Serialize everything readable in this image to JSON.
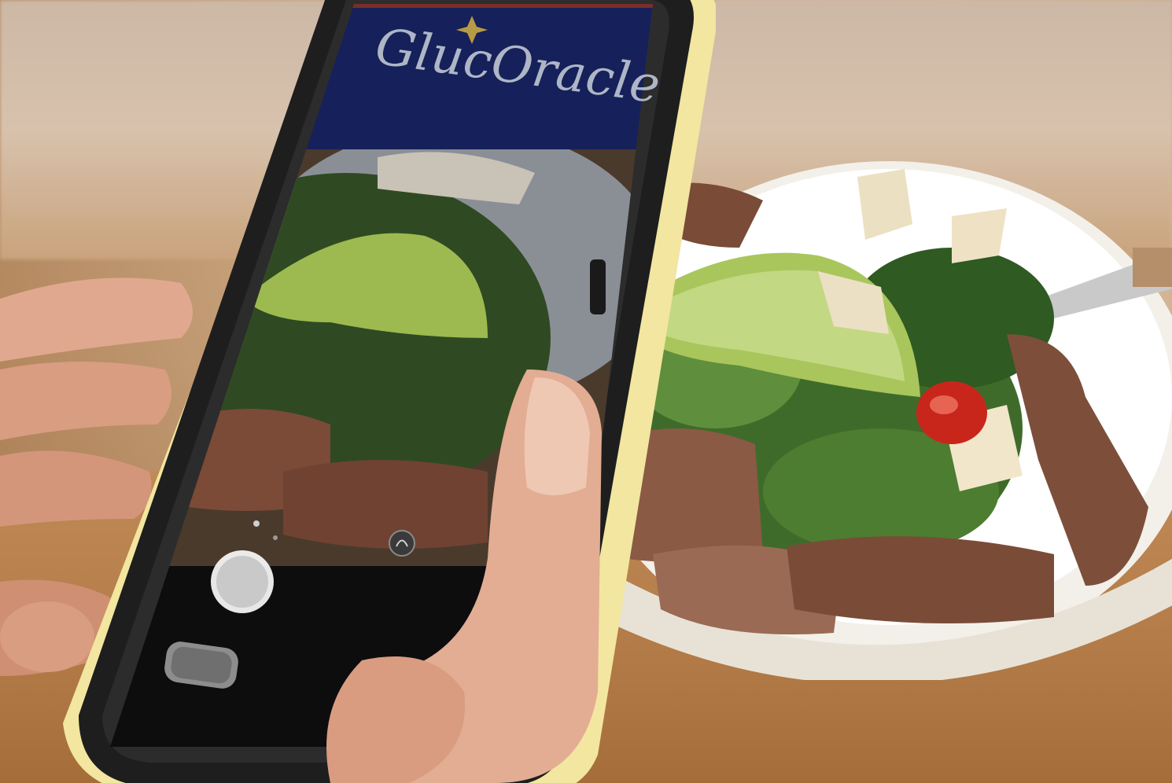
{
  "app": {
    "brand_name": "GlucOracle",
    "brand_icon": "sparkle-icon",
    "banner_color": "#16205a",
    "top_strip_color": "#7a2e28"
  },
  "camera": {
    "shutter_icon": "shutter-button-icon",
    "mode_icon": "scene-mode-icon",
    "home_icon": "home-button-icon"
  },
  "scene": {
    "subject": "steak-avocado-salad-plate"
  }
}
